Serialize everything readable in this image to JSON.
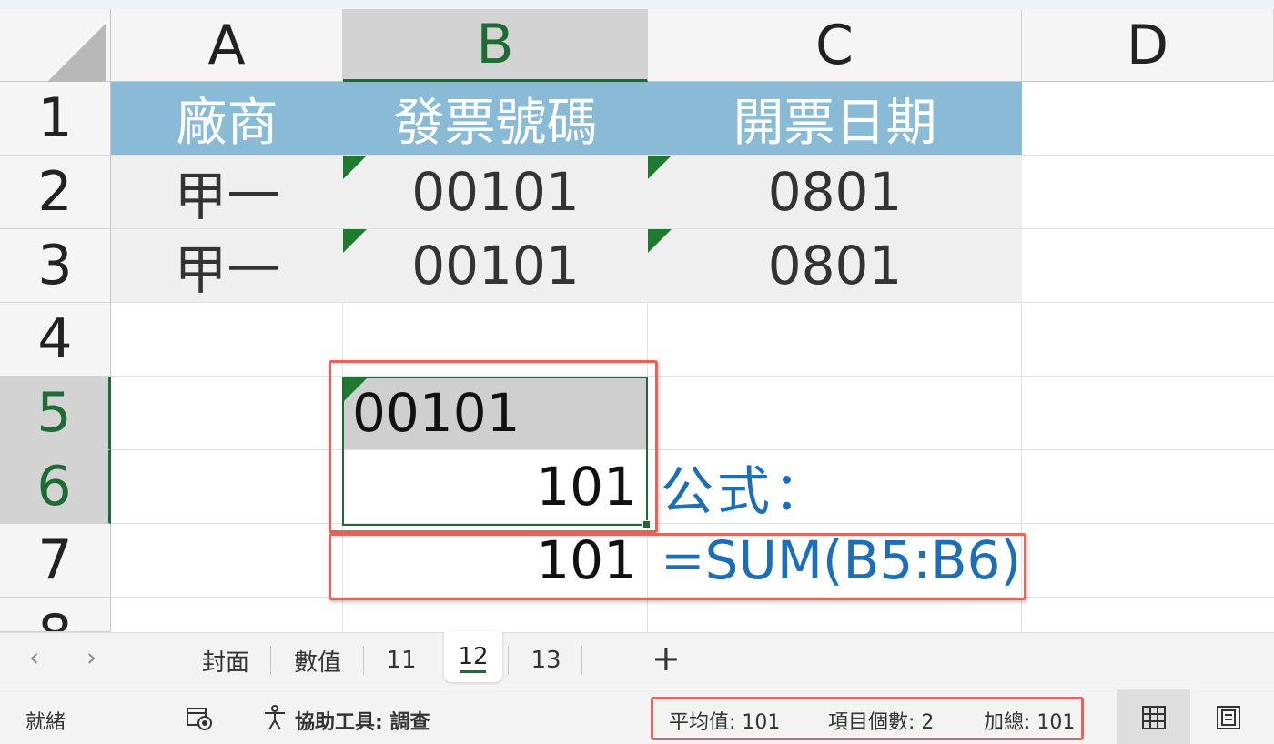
{
  "columns": [
    "A",
    "B",
    "C",
    "D"
  ],
  "rows": [
    "1",
    "2",
    "3",
    "4",
    "5",
    "6",
    "7",
    "8"
  ],
  "header_row": [
    "廠商",
    "發票號碼",
    "開票日期"
  ],
  "data_rows": [
    [
      "甲一",
      "00101",
      "0801"
    ],
    [
      "甲一",
      "00101",
      "0801"
    ]
  ],
  "b5": "00101",
  "b6": "101",
  "b7": "101",
  "c6": "公式：",
  "c7": "=SUM(B5:B6)",
  "sheet_tabs": [
    "封面",
    "數值",
    "11",
    "12",
    "13"
  ],
  "active_tab": "12",
  "add_tab": "+",
  "nav": {
    "prev": "‹",
    "next": "›"
  },
  "status": {
    "ready": "就緒",
    "accessibility": "協助工具: 調查",
    "average": "平均值: 101",
    "count": "項目個數: 2",
    "sum": "加總: 101"
  },
  "colors": {
    "header_fill": "#8abbd6",
    "selection": "#1e6b35",
    "annotation": "#e8635a",
    "formula_text": "#1a6fb8"
  },
  "icons": [
    "macro-record-icon",
    "accessibility-icon",
    "normal-view-icon",
    "page-layout-icon"
  ]
}
